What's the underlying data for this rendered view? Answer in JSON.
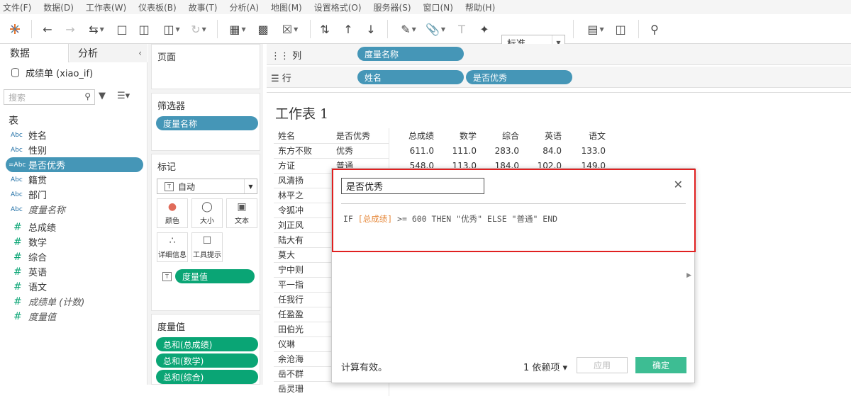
{
  "menu": [
    "文件(F)",
    "数据(D)",
    "工作表(W)",
    "仪表板(B)",
    "故事(T)",
    "分析(A)",
    "地图(M)",
    "设置格式(O)",
    "服务器(S)",
    "窗口(N)",
    "帮助(H)"
  ],
  "toolbar": {
    "fit_value": "标准"
  },
  "left_pane": {
    "tab_data": "数据",
    "tab_analysis": "分析",
    "datasource": "成绩单 (xiao_if)",
    "search_placeholder": "搜索",
    "table_label": "表",
    "fields": [
      {
        "type": "Abc",
        "name": "姓名"
      },
      {
        "type": "Abc",
        "name": "性别"
      },
      {
        "type": "=Abc",
        "name": "是否优秀",
        "selected": true
      },
      {
        "type": "Abc",
        "name": "籍贯"
      },
      {
        "type": "Abc",
        "name": "部门"
      },
      {
        "type": "Abc",
        "name": "度量名称",
        "italic": true
      },
      {
        "type": "#",
        "name": "总成绩"
      },
      {
        "type": "#",
        "name": "数学"
      },
      {
        "type": "#",
        "name": "综合"
      },
      {
        "type": "#",
        "name": "英语"
      },
      {
        "type": "#",
        "name": "语文"
      },
      {
        "type": "#",
        "name": "成绩单 (计数)",
        "italic": true
      },
      {
        "type": "#",
        "name": "度量值",
        "italic": true
      }
    ]
  },
  "cards": {
    "pages": "页面",
    "filters": "筛选器",
    "filter_pill": "度量名称",
    "marks": "标记",
    "mark_type": "自动",
    "mark_buttons": [
      "颜色",
      "大小",
      "文本",
      "详细信息",
      "工具提示"
    ],
    "mark_pill": "度量值",
    "measure_values": "度量值",
    "measure_pills": [
      "总和(总成绩)",
      "总和(数学)",
      "总和(综合)"
    ]
  },
  "shelves": {
    "columns_label": "列",
    "columns_pill": "度量名称",
    "rows_label": "行",
    "rows_pills": [
      "姓名",
      "是否优秀"
    ]
  },
  "view": {
    "title": "工作表 1",
    "headers": [
      "姓名",
      "是否优秀",
      "总成绩",
      "数学",
      "综合",
      "英语",
      "语文"
    ],
    "rows": [
      [
        "东方不败",
        "优秀",
        "611.0",
        "111.0",
        "283.0",
        "84.0",
        "133.0"
      ],
      [
        "方证",
        "普通",
        "548.0",
        "113.0",
        "184.0",
        "102.0",
        "149.0"
      ],
      [
        "风清扬"
      ],
      [
        "林平之"
      ],
      [
        "令狐冲"
      ],
      [
        "刘正风"
      ],
      [
        "陆大有"
      ],
      [
        "莫大"
      ],
      [
        "宁中则"
      ],
      [
        "平一指"
      ],
      [
        "任我行"
      ],
      [
        "任盈盈"
      ],
      [
        "田伯光"
      ],
      [
        "仪琳"
      ],
      [
        "余沧海"
      ],
      [
        "岳不群"
      ],
      [
        "岳灵珊"
      ]
    ]
  },
  "dialog": {
    "field_name": "是否优秀",
    "formula_prefix": "IF ",
    "formula_field": "[总成绩]",
    "formula_suffix": " >= 600 THEN \"优秀\" ELSE \"普通\" END",
    "status": "计算有效。",
    "dependencies": "1 依赖项",
    "apply": "应用",
    "ok": "确定"
  }
}
